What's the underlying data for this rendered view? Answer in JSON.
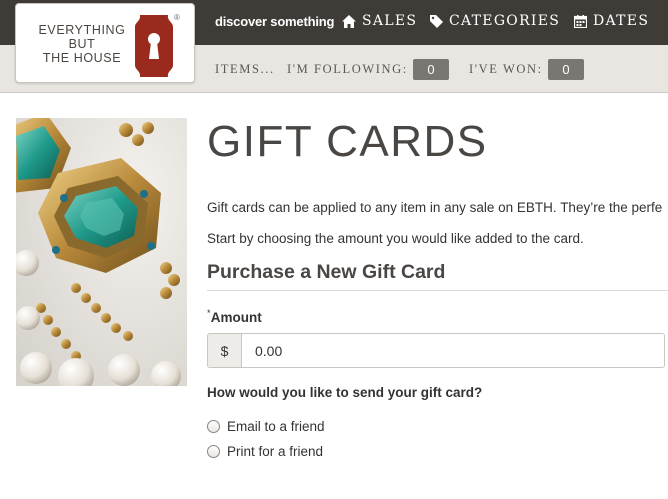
{
  "logo": {
    "line1": "EVERYTHING",
    "line2": "BUT",
    "line3": "THE HOUSE",
    "registered": "®",
    "brand_color": "#9b2a1e"
  },
  "header": {
    "discover_label": "discover something",
    "nav": [
      {
        "label": "SALES",
        "icon": "home-icon"
      },
      {
        "label": "CATEGORIES",
        "icon": "tag-icon"
      },
      {
        "label": "DATES",
        "icon": "calendar-icon"
      }
    ]
  },
  "subnav": {
    "items_label": "ITEMS...",
    "following_label": "I'M FOLLOWING:",
    "following_count": "0",
    "won_label": "I'VE WON:",
    "won_count": "0"
  },
  "main": {
    "title": "GIFT CARDS",
    "intro": "Gift cards can be applied to any item in any sale on EBTH. They’re the perfe",
    "instruction": "Start by choosing the amount you would like added to the card.",
    "section_title": "Purchase a New Gift Card",
    "amount": {
      "required_mark": "*",
      "label": "Amount",
      "currency": "$",
      "value": "0.00"
    },
    "send_question": "How would you like to send your gift card?",
    "options": [
      {
        "label": "Email to a friend"
      },
      {
        "label": "Print for a friend"
      }
    ]
  },
  "colors": {
    "topbar": "#3f3c38",
    "subbar": "#e9e6e1",
    "badge": "#7a7772"
  }
}
